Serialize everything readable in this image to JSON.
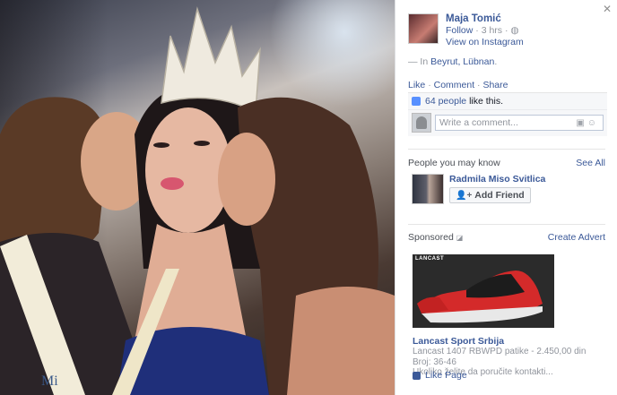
{
  "window": {
    "close_symbol": "✕"
  },
  "author": {
    "name": "Maja Tomić",
    "follow": "Follow",
    "time": "3 hrs",
    "view_on_instagram": "View on Instagram"
  },
  "location": {
    "prefix": "— In",
    "place": "Beyrut, Lübnan",
    "suffix": "."
  },
  "actions": {
    "like": "Like",
    "comment": "Comment",
    "share": "Share"
  },
  "likes": {
    "count": "64 people",
    "suffix": "like this."
  },
  "comment_box": {
    "placeholder": "Write a comment..."
  },
  "people_you_may_know": {
    "title": "People you may know",
    "see_all": "See All",
    "person": {
      "name": "Radmila Miso Svitlica",
      "button": "Add Friend"
    }
  },
  "sponsored": {
    "title": "Sponsored",
    "create_advert": "Create Advert",
    "ad": {
      "logo": "LANCAST",
      "title": "Lancast Sport Srbija",
      "line1": "Lancast 1407 RBWPD patike - 2.450,00 din Broj: 36-46",
      "line2": "Ukoliko želite da poručite kontakti...",
      "like_page": "Like Page"
    }
  },
  "photo": {
    "sash_text": "Mi"
  }
}
